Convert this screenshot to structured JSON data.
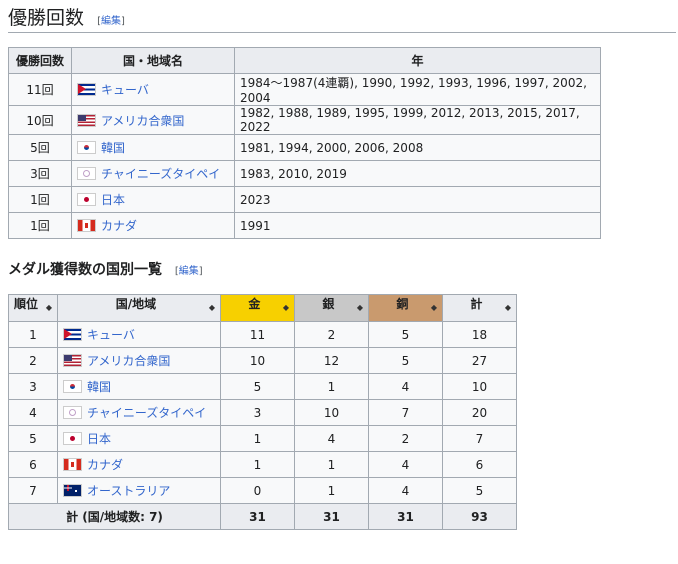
{
  "sections": {
    "wins_title": "優勝回数",
    "medal_title": "メダル獲得数の国別一覧",
    "edit_open": "[",
    "edit_label": "編集",
    "edit_close": "]"
  },
  "wins_table": {
    "headers": [
      "優勝回数",
      "国・地域名",
      "年"
    ],
    "rows": [
      {
        "count": "11回",
        "flag": "cuba-flag",
        "country": "キューバ",
        "years": "1984〜1987(4連覇), 1990, 1992, 1993, 1996, 1997, 2002, 2004"
      },
      {
        "count": "10回",
        "flag": "usa-flag",
        "country": "アメリカ合衆国",
        "years": "1982, 1988, 1989, 1995, 1999, 2012, 2013, 2015, 2017, 2022"
      },
      {
        "count": "5回",
        "flag": "korea-flag",
        "country": "韓国",
        "years": "1981, 1994, 2000, 2006, 2008"
      },
      {
        "count": "3回",
        "flag": "chinese-taipei-flag",
        "country": "チャイニーズタイペイ",
        "years": "1983, 2010, 2019"
      },
      {
        "count": "1回",
        "flag": "japan-flag",
        "country": "日本",
        "years": "2023"
      },
      {
        "count": "1回",
        "flag": "canada-flag",
        "country": "カナダ",
        "years": "1991"
      }
    ]
  },
  "medal_table": {
    "headers": [
      "順位",
      "国/地域",
      "金",
      "銀",
      "銅",
      "計"
    ],
    "sort_glyph": "◆",
    "colors": {
      "gold": "#f7d000",
      "silver": "#c8c8c8",
      "bronze": "#c99a6e"
    },
    "rows": [
      {
        "rank": "1",
        "flag": "cuba-flag",
        "country": "キューバ",
        "gold": "11",
        "silver": "2",
        "bronze": "5",
        "total": "18"
      },
      {
        "rank": "2",
        "flag": "usa-flag",
        "country": "アメリカ合衆国",
        "gold": "10",
        "silver": "12",
        "bronze": "5",
        "total": "27"
      },
      {
        "rank": "3",
        "flag": "korea-flag",
        "country": "韓国",
        "gold": "5",
        "silver": "1",
        "bronze": "4",
        "total": "10"
      },
      {
        "rank": "4",
        "flag": "chinese-taipei-flag",
        "country": "チャイニーズタイペイ",
        "gold": "3",
        "silver": "10",
        "bronze": "7",
        "total": "20"
      },
      {
        "rank": "5",
        "flag": "japan-flag",
        "country": "日本",
        "gold": "1",
        "silver": "4",
        "bronze": "2",
        "total": "7"
      },
      {
        "rank": "6",
        "flag": "canada-flag",
        "country": "カナダ",
        "gold": "1",
        "silver": "1",
        "bronze": "4",
        "total": "6"
      },
      {
        "rank": "7",
        "flag": "australia-flag",
        "country": "オーストラリア",
        "gold": "0",
        "silver": "1",
        "bronze": "4",
        "total": "5"
      }
    ],
    "totals": {
      "label": "計 (国/地域数: 7)",
      "gold": "31",
      "silver": "31",
      "bronze": "31",
      "total": "93"
    }
  }
}
